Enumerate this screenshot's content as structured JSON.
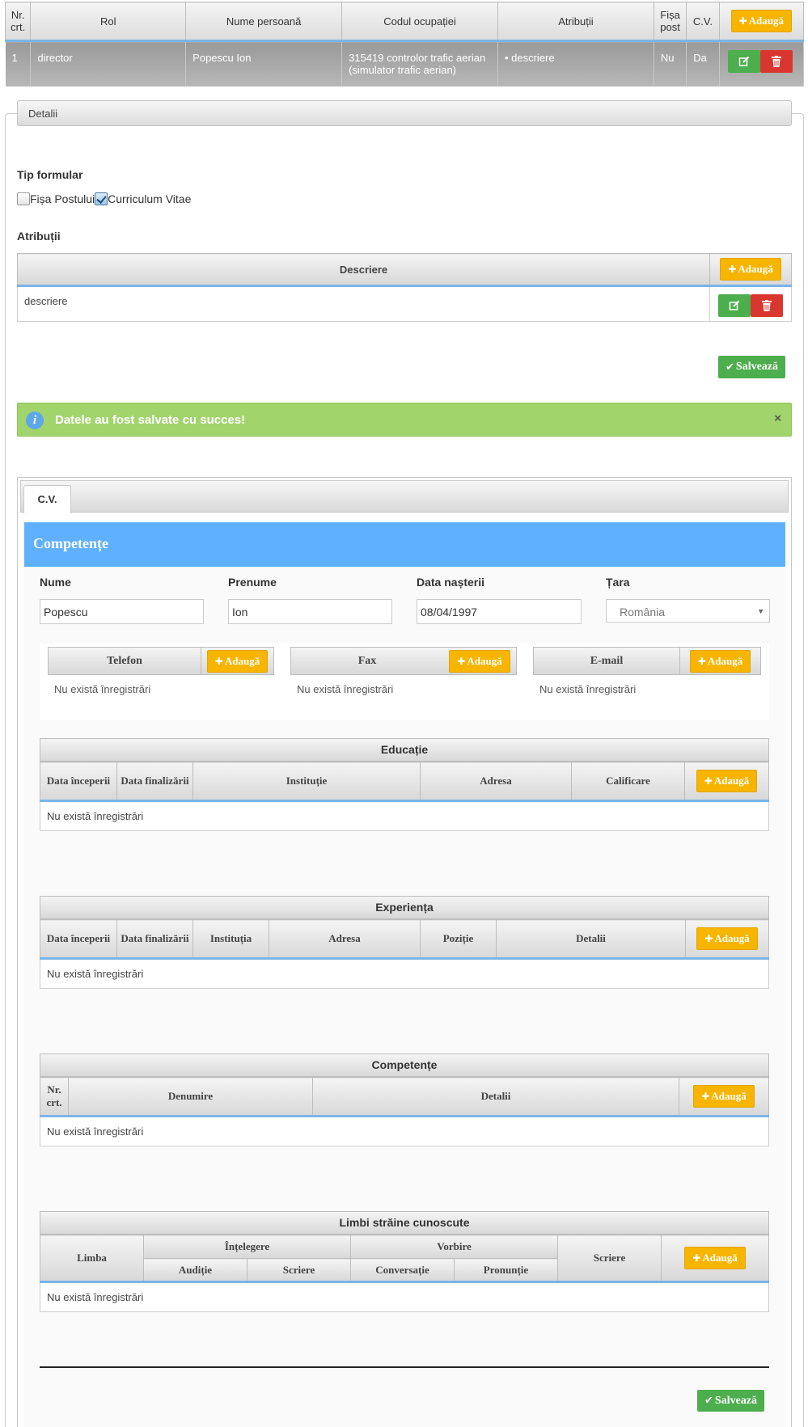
{
  "top_table": {
    "headers": [
      "Nr. crt.",
      "Rol",
      "Nume persoană",
      "Codul ocupației",
      "Atribuții",
      "Fișa post",
      "C.V."
    ],
    "add_label": "Adaugă",
    "row": {
      "nr": "1",
      "rol": "director",
      "nume": "Popescu Ion",
      "cod": "315419 controlor trafic aerian (simulator trafic aerian)",
      "atributii": "• descriere",
      "fisa_post": "Nu",
      "cv": "Da"
    }
  },
  "details": {
    "title": "Detalii",
    "tip_formular_label": "Tip formular",
    "checkbox_fisa": "Fișa Postului",
    "checkbox_cv": "Curriculum Vitae",
    "atributii_label": "Atribuții",
    "atributii_table": {
      "header": "Descriere",
      "add_label": "Adaugă",
      "rows": [
        "descriere"
      ]
    },
    "save_label": "Salvează"
  },
  "alert": {
    "message": "Datele au fost salvate cu succes!",
    "close": "×"
  },
  "cv": {
    "tab_label": "C.V.",
    "section_title": "Competențe",
    "fields": {
      "nume_label": "Nume",
      "nume_value": "Popescu",
      "prenume_label": "Prenume",
      "prenume_value": "Ion",
      "data_label": "Data nașterii",
      "data_value": "08/04/1997",
      "tara_label": "Țara",
      "tara_value": "România"
    },
    "contacts": [
      {
        "header": "Telefon",
        "empty": "Nu există înregistrări"
      },
      {
        "header": "Fax",
        "empty": "Nu există înregistrări"
      },
      {
        "header": "E-mail",
        "empty": "Nu există înregistrări"
      }
    ],
    "educatie": {
      "title": "Educație",
      "headers": [
        "Data începerii",
        "Data finalizării",
        "Instituție",
        "Adresa",
        "Calificare"
      ],
      "empty": "Nu există înregistrări"
    },
    "experienta": {
      "title": "Experiența",
      "headers": [
        "Data începerii",
        "Data finalizării",
        "Instituția",
        "Adresa",
        "Poziție",
        "Detalii"
      ],
      "empty": "Nu există înregistrări"
    },
    "competente": {
      "title": "Competențe",
      "headers": [
        "Nr. crt.",
        "Denumire",
        "Detalii"
      ],
      "empty": "Nu există înregistrări"
    },
    "limbi": {
      "title": "Limbi străine cunoscute",
      "limba": "Limba",
      "intelegere": "Înțelegere",
      "vorbire": "Vorbire",
      "scriere": "Scriere",
      "sub": [
        "Audiție",
        "Scriere",
        "Conversație",
        "Pronunție"
      ],
      "empty": "Nu există înregistrări"
    },
    "add_label": "Adaugă",
    "save_label": "Salvează"
  },
  "colors": {
    "accent_yellow": "#f7b500",
    "success_green": "#4cae4c",
    "danger_red": "#d9362f",
    "header_blue": "#5fb0ff",
    "alert_green": "#a2d46c"
  }
}
